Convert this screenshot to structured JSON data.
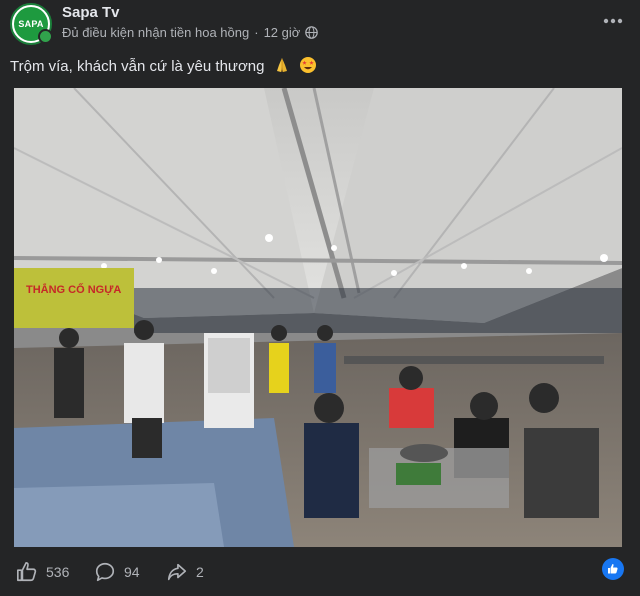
{
  "post": {
    "page_name": "Sapa Tv",
    "avatar_text": "SAPA",
    "eligibility": "Đủ điều kiện nhận tiền hoa hồng",
    "separator": "·",
    "time": "12 giờ",
    "audience_icon": "globe-icon",
    "more_icon": "more-dots-icon",
    "caption": "Trộm vía, khách vẫn cứ là yêu thương",
    "caption_emojis": [
      "folded-hands-emoji",
      "star-struck-emoji"
    ]
  },
  "photo": {
    "subject": "crowded night food market under a white tent",
    "banner_text": "THẮNG CỐ NGỰA"
  },
  "actions": {
    "likes": "536",
    "comments": "94",
    "shares": "2",
    "reaction_badge": "like-reaction-icon"
  },
  "colors": {
    "background": "#242526",
    "text_primary": "#e4e6eb",
    "text_secondary": "#b0b3b8",
    "online": "#31a24c",
    "brand_blue": "#1877f2",
    "avatar_green": "#1e9a3f"
  }
}
